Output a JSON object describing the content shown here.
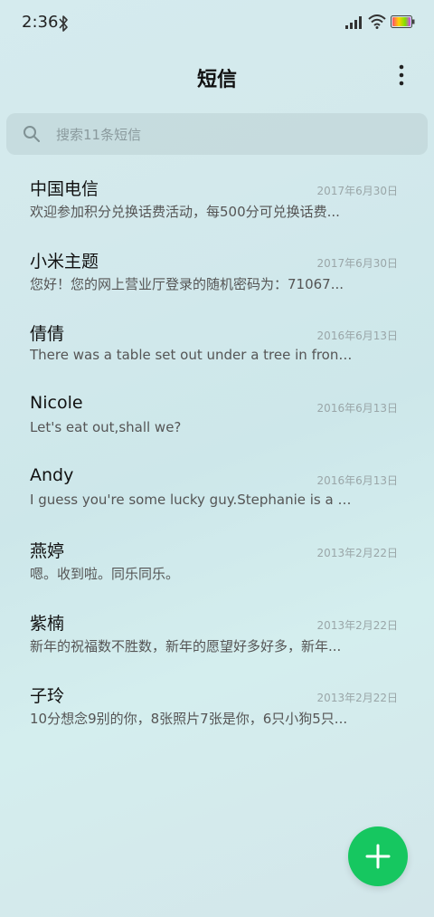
{
  "status_bar": {
    "time": "2:36",
    "icons": [
      "bluetooth-icon",
      "signal-icon",
      "wifi-icon",
      "battery-icon"
    ]
  },
  "header": {
    "title": "短信",
    "menu_icon": "more-vertical-icon"
  },
  "search": {
    "placeholder": "搜索11条短信",
    "icon": "search-icon"
  },
  "conversations": [
    {
      "name": "中国电信",
      "date": "2017年6月30日",
      "preview": "欢迎参加积分兑换话费活动，每500分可兑换话费..."
    },
    {
      "name": "小米主题",
      "date": "2017年6月30日",
      "preview": "您好！您的网上营业厅登录的随机密码为：71067..."
    },
    {
      "name": "倩倩",
      "date": "2016年6月13日",
      "preview": "There was a table set out under a tree in front o..."
    },
    {
      "name": "Nicole",
      "date": "2016年6月13日",
      "preview": "Let's eat out,shall we?"
    },
    {
      "name": "Andy",
      "date": "2016年6月13日",
      "preview": "I guess you're some lucky guy.Stephanie is a n..."
    },
    {
      "name": "燕婷",
      "date": "2013年2月22日",
      "preview": "嗯。收到啦。同乐同乐。"
    },
    {
      "name": "紫楠",
      "date": "2013年2月22日",
      "preview": "新年的祝福数不胜数，新年的愿望好多好多，新年..."
    },
    {
      "name": "子玲",
      "date": "2013年2月22日",
      "preview": "10分想念9别的你，8张照片7张是你，6只小狗5只..."
    }
  ],
  "fab": {
    "icon": "plus-icon",
    "color": "#16c760"
  },
  "colors": {
    "accent": "#16c760",
    "background": "#d3e9ec"
  }
}
